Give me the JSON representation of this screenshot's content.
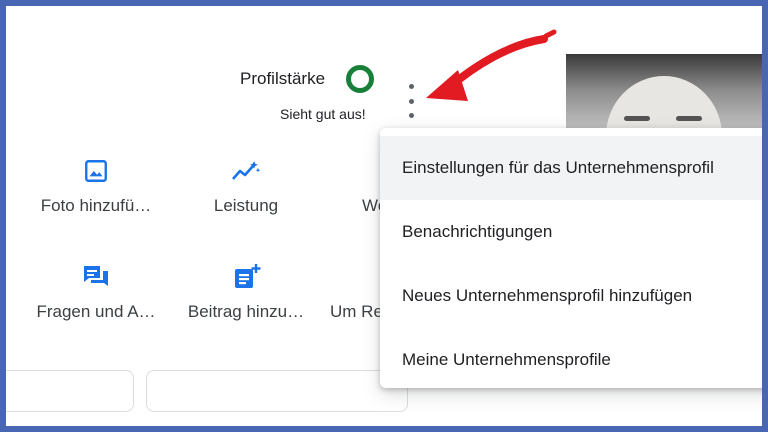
{
  "profile": {
    "strength_label": "Profilstärke",
    "strength_status": "Sieht gut aus!",
    "strength_color": "#188038"
  },
  "actions": [
    {
      "label": "Foto hinzufü…",
      "icon": "photo-icon"
    },
    {
      "label": "Leistung",
      "icon": "performance-icon"
    },
    {
      "label": "We",
      "icon": "website-icon"
    },
    {
      "label": "Fragen und A…",
      "icon": "qa-icon"
    },
    {
      "label": "Beitrag hinzu…",
      "icon": "add-post-icon"
    },
    {
      "label": "Um Re",
      "icon": "reviews-icon"
    }
  ],
  "menu": {
    "items": [
      {
        "label": "Einstellungen für das Unternehmensprofil"
      },
      {
        "label": "Benachrichtigungen"
      },
      {
        "label": "Neues Unternehmensprofil hinzufügen"
      },
      {
        "label": "Meine Unternehmensprofile"
      }
    ]
  },
  "colors": {
    "frame": "#4866b4",
    "icon_blue": "#1a73e8",
    "arrow_red": "#e21b22"
  }
}
